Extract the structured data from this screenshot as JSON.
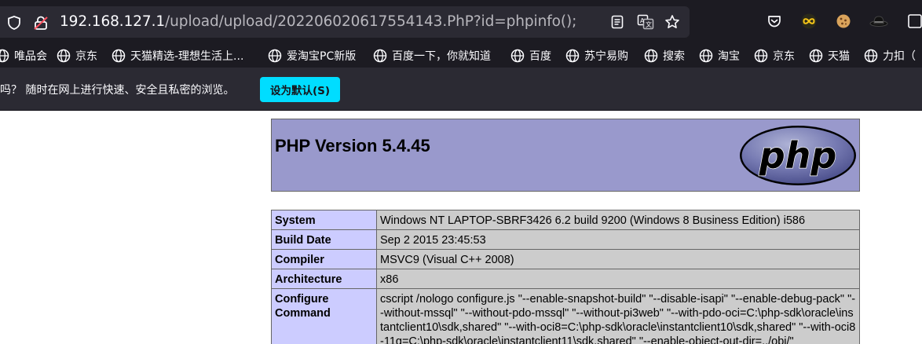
{
  "browser": {
    "url_host": "192.168.127.1",
    "url_path": "/upload/upload/202206020617554143.PhP?id=phpinfo();",
    "toolbar_icons": [
      "reader-view-icon",
      "translate-icon",
      "bookmark-star-icon",
      "pocket-icon",
      "extension-infinity-icon",
      "extension-cookie-icon",
      "extension-hat-icon",
      "extensions-overflow-icon"
    ]
  },
  "bookmarks": [
    {
      "label": "唯品会"
    },
    {
      "label": "京东"
    },
    {
      "label": "天猫精选-理想生活上..."
    },
    {
      "label": "爱淘宝PC新版"
    },
    {
      "label": "百度一下，你就知道"
    },
    {
      "label": "百度"
    },
    {
      "label": "苏宁易购"
    },
    {
      "label": "搜索"
    },
    {
      "label": "淘宝"
    },
    {
      "label": "京东"
    },
    {
      "label": "天猫"
    },
    {
      "label": "力扣（"
    }
  ],
  "notification": {
    "text": "吗？ 随时在网上进行快速、安全且私密的浏览。",
    "button_label": "设为默认(S)"
  },
  "phpinfo": {
    "version_title": "PHP Version 5.4.45",
    "logo_text": "php",
    "rows": [
      {
        "key": "System",
        "value": "Windows NT LAPTOP-SBRF3426 6.2 build 9200 (Windows 8 Business Edition) i586"
      },
      {
        "key": "Build Date",
        "value": "Sep 2 2015 23:45:53"
      },
      {
        "key": "Compiler",
        "value": "MSVC9 (Visual C++ 2008)"
      },
      {
        "key": "Architecture",
        "value": "x86"
      },
      {
        "key": "Configure Command",
        "value": "cscript /nologo configure.js \"--enable-snapshot-build\" \"--disable-isapi\" \"--enable-debug-pack\" \"--without-mssql\" \"--without-pdo-mssql\" \"--without-pi3web\" \"--with-pdo-oci=C:\\php-sdk\\oracle\\instantclient10\\sdk,shared\" \"--with-oci8=C:\\php-sdk\\oracle\\instantclient10\\sdk,shared\" \"--with-oci8-11g=C:\\php-sdk\\oracle\\instantclient11\\sdk,shared\" \"--enable-object-out-dir=../obj/\""
      }
    ]
  },
  "colors": {
    "browser_bg": "#1c1b22",
    "urlbar_bg": "#2b2a33",
    "accent_button": "#00ddff",
    "php_header": "#9999cc",
    "php_key_cell": "#ccccff",
    "php_value_cell": "#cccccc"
  }
}
